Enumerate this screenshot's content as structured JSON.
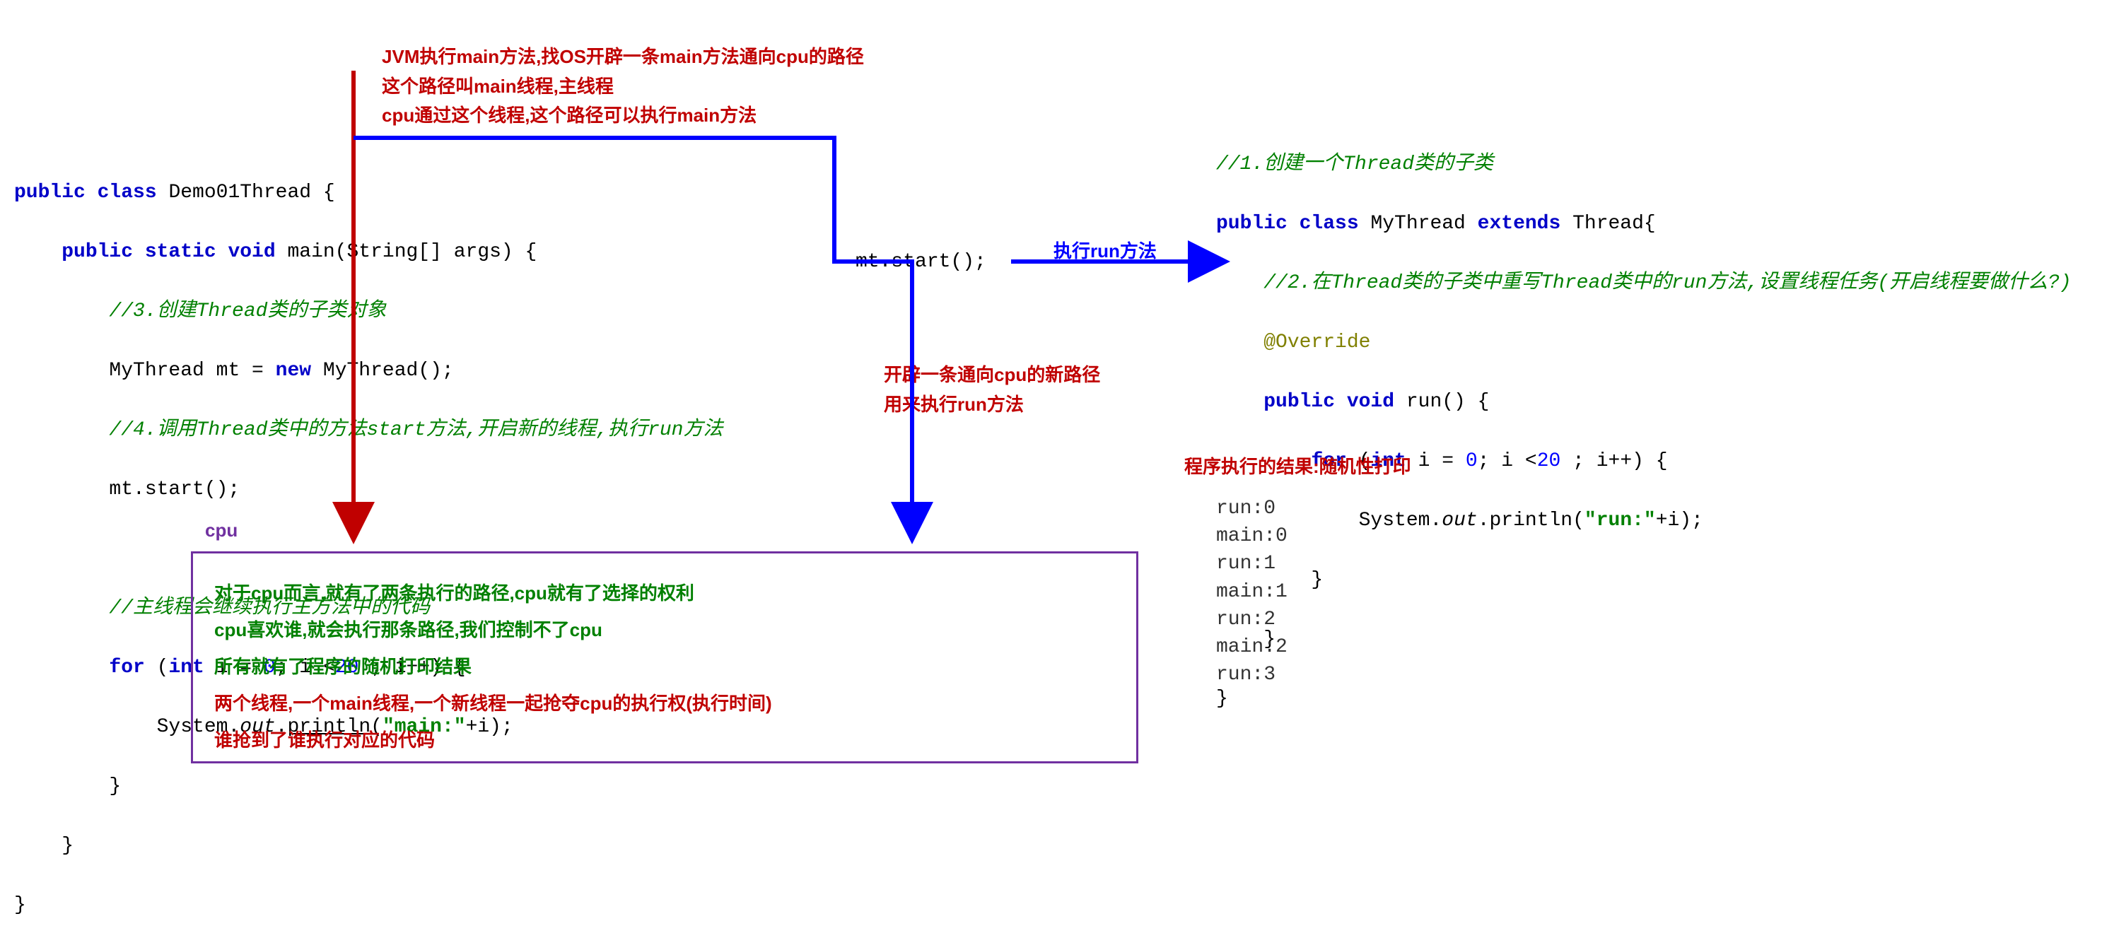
{
  "top_notes": {
    "line1": "JVM执行main方法,找OS开辟一条main方法通向cpu的路径",
    "line2": "这个路径叫main线程,主线程",
    "line3": "cpu通过这个线程,这个路径可以执行main方法"
  },
  "code_left": {
    "l1_a": "public class ",
    "l1_b": "Demo01Thread {",
    "l2_a": "    public static void ",
    "l2_b": "main(String[] args) {",
    "l3": "        //3.创建Thread类的子类对象",
    "l4_a": "        MyThread mt = ",
    "l4_b": "new ",
    "l4_c": "MyThread();",
    "l5": "        //4.调用Thread类中的方法start方法,开启新的线程,执行run方法",
    "l6": "        mt.start();",
    "l7": "",
    "l8": "        //主线程会继续执行主方法中的代码",
    "l9_a": "        for ",
    "l9_b": "(",
    "l9_c": "int ",
    "l9_d": "i = ",
    "l9_e": "0",
    "l9_f": "; i <",
    "l9_g": "20",
    "l9_h": " ; i++) {",
    "l10_a": "            System.",
    "l10_b": "out",
    "l10_c": ".",
    "l10_d": "println",
    "l10_e": "(",
    "l10_f": "\"main:\"",
    "l10_g": "+i);",
    "l11": "        }",
    "l12": "    }",
    "l13": "}"
  },
  "mid_call": "mt.start();",
  "run_label": "执行run方法",
  "mid_notes": {
    "line1": "开辟一条通向cpu的新路径",
    "line2": "用来执行run方法"
  },
  "code_right": {
    "l1": "//1.创建一个Thread类的子类",
    "l2_a": "public class ",
    "l2_b": "MyThread ",
    "l2_c": "extends ",
    "l2_d": "Thread{",
    "l3": "    //2.在Thread类的子类中重写Thread类中的run方法,设置线程任务(开启线程要做什么?)",
    "l4": "    @Override",
    "l5_a": "    public void ",
    "l5_b": "run() {",
    "l6_a": "        for ",
    "l6_b": "(",
    "l6_c": "int ",
    "l6_d": "i = ",
    "l6_e": "0",
    "l6_f": "; i <",
    "l6_g": "20",
    "l6_h": " ; i++) {",
    "l7_a": "            System.",
    "l7_b": "out",
    "l7_c": ".println(",
    "l7_d": "\"run:\"",
    "l7_e": "+i);",
    "l8": "        }",
    "l9": "    }",
    "l10": "}"
  },
  "result_label": "程序执行的结果:随机性打印",
  "output": [
    "run:0",
    "main:0",
    "run:1",
    "main:1",
    "run:2",
    "main:2",
    "run:3"
  ],
  "cpu_label": "cpu",
  "cpu_box": {
    "g1": "对于cpu而言,就有了两条执行的路径,cpu就有了选择的权利",
    "g2": "cpu喜欢谁,就会执行那条路径,我们控制不了cpu",
    "g3": "所有就有了程序的随机打印结果",
    "r1": "两个线程,一个main线程,一个新线程一起抢夺cpu的执行权(执行时间)",
    "r2": "谁抢到了谁执行对应的代码"
  }
}
